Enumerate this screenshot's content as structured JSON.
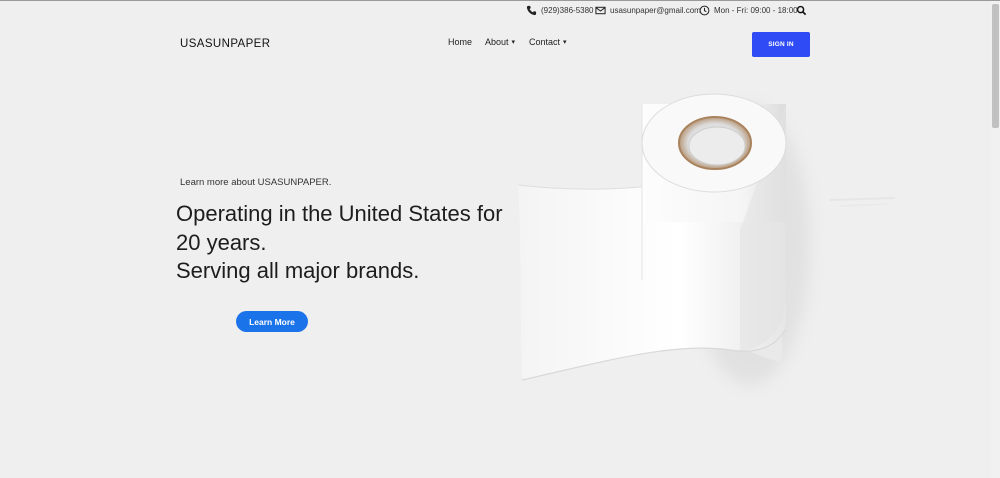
{
  "topbar": {
    "phone": "(929)386-5380",
    "email": "usasunpaper@gmail.com",
    "hours": "Mon - Fri: 09:00 - 18:00"
  },
  "header": {
    "logo": "USASUNPAPER",
    "nav": [
      {
        "label": "Home"
      },
      {
        "label": "About"
      },
      {
        "label": "Contact"
      }
    ],
    "signin_label": "SIGN IN"
  },
  "hero": {
    "eyebrow": "Learn more about USASUNPAPER.",
    "headline_lines": [
      "Operating in the United States for",
      "20 years.",
      "Serving all major brands."
    ],
    "cta_label": "Learn More"
  },
  "icons": {
    "phone": "phone-icon",
    "email": "envelope-icon",
    "clock": "clock-icon",
    "search": "search-icon",
    "caret": "chevron-down-icon"
  },
  "colors": {
    "background": "#efefef",
    "signin": "#2f4bf5",
    "cta": "#1a73e8"
  }
}
